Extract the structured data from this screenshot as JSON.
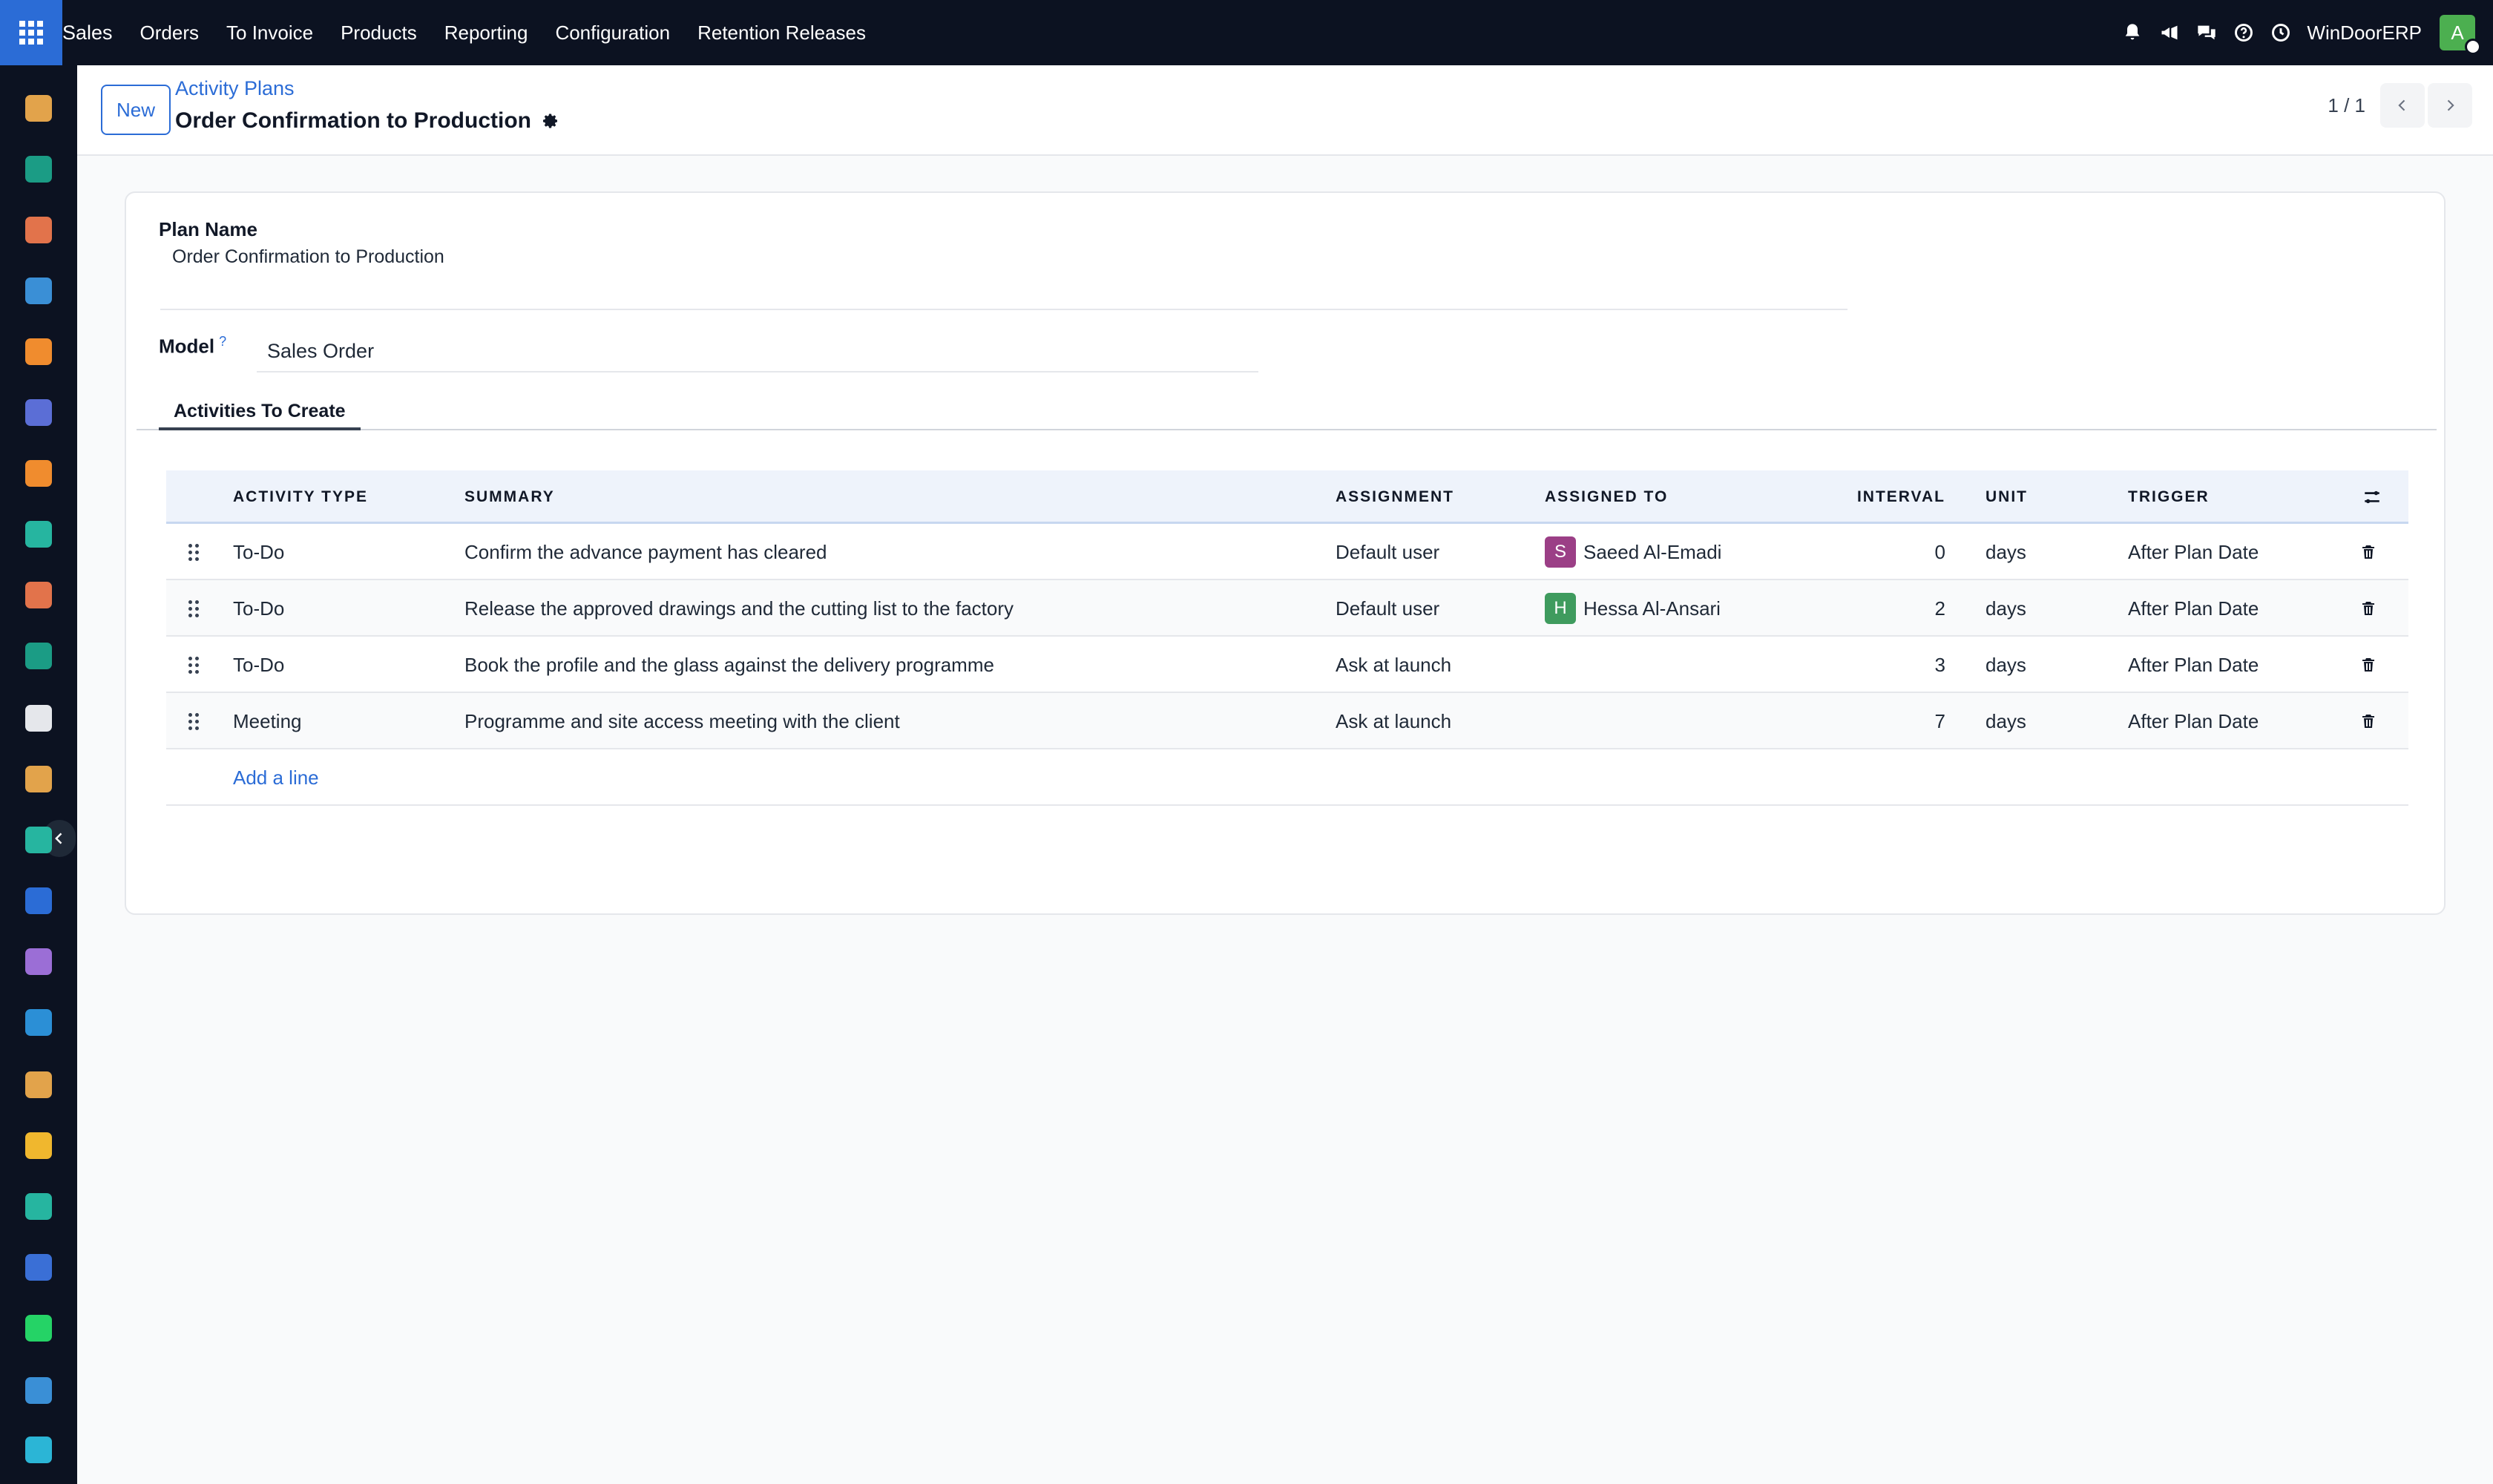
{
  "topbar": {
    "menu": [
      "Sales",
      "Orders",
      "To Invoice",
      "Products",
      "Reporting",
      "Configuration",
      "Retention Releases"
    ],
    "company": "WinDoorERP",
    "user_initial": "A",
    "icons": [
      "bell-icon",
      "megaphone-icon",
      "chat-icon",
      "help-icon",
      "clock-icon"
    ]
  },
  "control": {
    "new_label": "New",
    "breadcrumb": "Activity Plans",
    "record_title": "Order Confirmation to Production",
    "pager": "1 / 1"
  },
  "form": {
    "plan_name_label": "Plan Name",
    "plan_name_value": "Order Confirmation to Production",
    "model_label": "Model",
    "model_help": "?",
    "model_value": "Sales Order",
    "tab_label": "Activities To Create"
  },
  "table": {
    "headers": {
      "activity_type": "ACTIVITY TYPE",
      "summary": "SUMMARY",
      "assignment": "ASSIGNMENT",
      "assigned_to": "ASSIGNED TO",
      "interval": "INTERVAL",
      "unit": "UNIT",
      "trigger": "TRIGGER"
    },
    "rows": [
      {
        "type": "To-Do",
        "summary": "Confirm the advance payment has cleared",
        "assignment": "Default user",
        "assignee_initial": "S",
        "assignee": "Saeed Al-Emadi",
        "assignee_color": "#9b3f86",
        "interval": "0",
        "unit": "days",
        "trigger": "After Plan Date"
      },
      {
        "type": "To-Do",
        "summary": "Release the approved drawings and the cutting list to the factory",
        "assignment": "Default user",
        "assignee_initial": "H",
        "assignee": "Hessa Al-Ansari",
        "assignee_color": "#3f9b5e",
        "interval": "2",
        "unit": "days",
        "trigger": "After Plan Date"
      },
      {
        "type": "To-Do",
        "summary": "Book the profile and the glass against the delivery programme",
        "assignment": "Ask at launch",
        "assignee_initial": "",
        "assignee": "",
        "assignee_color": "",
        "interval": "3",
        "unit": "days",
        "trigger": "After Plan Date"
      },
      {
        "type": "Meeting",
        "summary": "Programme and site access meeting with the client",
        "assignment": "Ask at launch",
        "assignee_initial": "",
        "assignee": "",
        "assignee_color": "",
        "interval": "7",
        "unit": "days",
        "trigger": "After Plan Date"
      }
    ],
    "add_line": "Add a line"
  },
  "dock_apps": [
    {
      "name": "dock-app-discuss-icon",
      "color": "#e2a34b"
    },
    {
      "name": "dock-app-contacts-icon",
      "color": "#1b9c85"
    },
    {
      "name": "dock-app-sales-icon",
      "color": "#e2734b"
    },
    {
      "name": "dock-app-dashboard-icon",
      "color": "#3a8fd6"
    },
    {
      "name": "dock-app-crm-icon",
      "color": "#f08c2e"
    },
    {
      "name": "dock-app-mail-icon",
      "color": "#5b6ed6"
    },
    {
      "name": "dock-app-livechat-icon",
      "color": "#f08c2e"
    },
    {
      "name": "dock-app-purchase-icon",
      "color": "#26b5a0"
    },
    {
      "name": "dock-app-reporting-icon",
      "color": "#e2734b"
    },
    {
      "name": "dock-app-employees-icon",
      "color": "#1b9c85"
    },
    {
      "name": "dock-app-inventory-icon",
      "color": "#e5e7eb"
    },
    {
      "name": "dock-app-manufacturing-icon",
      "color": "#e2a34b"
    },
    {
      "name": "dock-app-project-icon",
      "color": "#26b5a0"
    },
    {
      "name": "dock-app-knowledge-icon",
      "color": "#2b6cd6"
    },
    {
      "name": "dock-app-barcode-icon",
      "color": "#9b6ed6"
    },
    {
      "name": "dock-app-invoicing-icon",
      "color": "#2b8fd6"
    },
    {
      "name": "dock-app-recruitment-icon",
      "color": "#e2a34b"
    },
    {
      "name": "dock-app-calendar-icon",
      "color": "#f0b72e"
    },
    {
      "name": "dock-app-sign-icon",
      "color": "#26b5a0"
    },
    {
      "name": "dock-app-dashboards-icon",
      "color": "#3a6fd6"
    },
    {
      "name": "dock-app-whatsapp-icon",
      "color": "#25d366"
    },
    {
      "name": "dock-app-timesheet-icon",
      "color": "#3a8fd6"
    },
    {
      "name": "dock-app-website-icon",
      "color": "#2bb5d6"
    }
  ]
}
